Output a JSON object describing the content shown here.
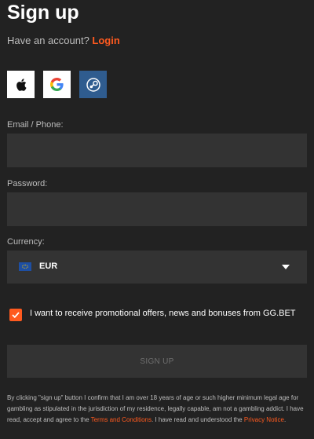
{
  "page": {
    "title": "Sign up",
    "have_account_text": "Have an account?",
    "login_label": "Login"
  },
  "social": [
    {
      "name": "apple",
      "icon": "apple-icon"
    },
    {
      "name": "google",
      "icon": "google-icon"
    },
    {
      "name": "steam",
      "icon": "steam-icon"
    }
  ],
  "form": {
    "email_label": "Email / Phone:",
    "email_value": "",
    "password_label": "Password:",
    "password_value": "",
    "currency_label": "Currency:",
    "currency_value": "EUR",
    "currency_flag": "eu-flag-icon",
    "promo_checked": true,
    "promo_label": "I want to receive promotional offers, news and bonuses from GG.BET",
    "submit_label": "SIGN UP"
  },
  "legal": {
    "text_1": "By clicking \"sign up\" button I confirm that I am over 18 years of age or such higher minimum legal age for gambling as stipulated in the jurisdiction of my residence, legally capable, am not a gambling addict. I have read, accept and agree to the ",
    "terms_link": "Terms and Conditions",
    "text_2": ". I have read and understood the ",
    "privacy_link": "Privacy Notice",
    "text_3": "."
  },
  "colors": {
    "background": "#222222",
    "field": "#333333",
    "accent": "#ff5a1f",
    "steam": "#2f5c8f"
  }
}
